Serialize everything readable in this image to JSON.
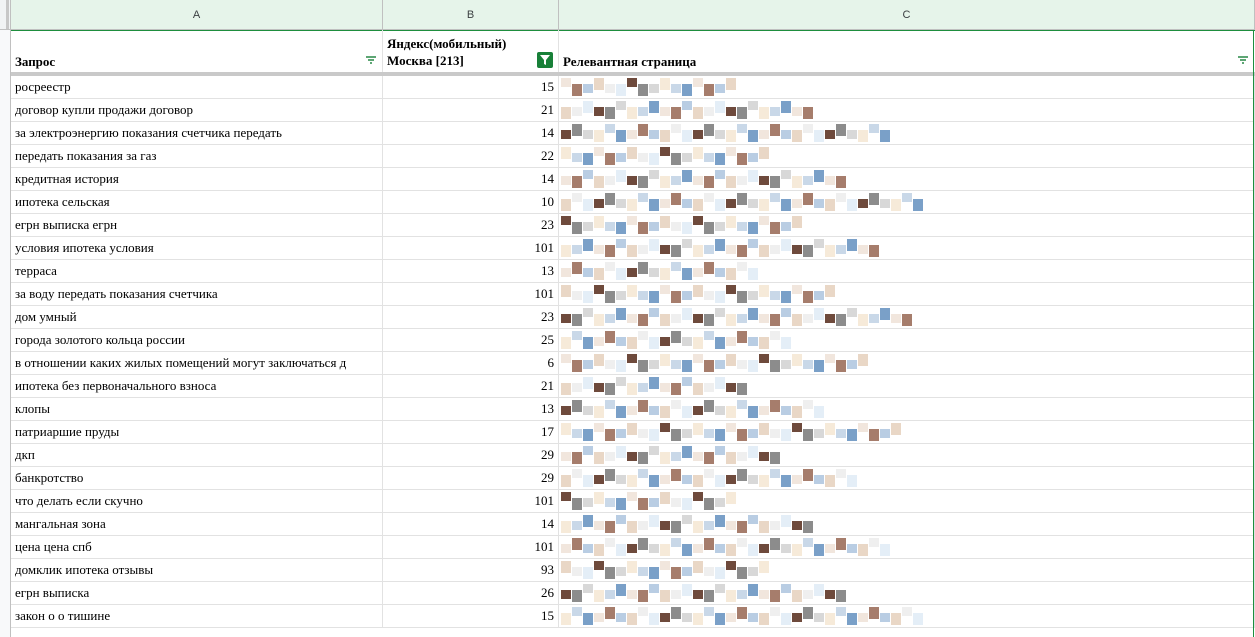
{
  "columns": [
    "A",
    "B",
    "C"
  ],
  "header": {
    "query_label": "Запрос",
    "position_label_line1": "Яндекс(мобильный)",
    "position_label_line2": "Москва [213]",
    "page_label": "Релевантная страница"
  },
  "icons": {
    "filter": "filter-icon",
    "filter_active": "filter-active-icon"
  },
  "colors": {
    "header_bg": "#e6f4ea",
    "accent_green": "#188038"
  },
  "rows": [
    {
      "query": "росреестр",
      "position": "15"
    },
    {
      "query": "договор купли продажи договор",
      "position": "21"
    },
    {
      "query": "за электроэнергию показания счетчика передать",
      "position": "14"
    },
    {
      "query": "передать показания за газ",
      "position": "22"
    },
    {
      "query": "кредитная история",
      "position": "14"
    },
    {
      "query": "ипотека сельская",
      "position": "10"
    },
    {
      "query": "егрн выписка егрн",
      "position": "23"
    },
    {
      "query": "условия ипотека условия",
      "position": "101"
    },
    {
      "query": "терраса",
      "position": "13"
    },
    {
      "query": "за воду передать показания счетчика",
      "position": "101"
    },
    {
      "query": "дом умный",
      "position": "23"
    },
    {
      "query": "города золотого кольца россии",
      "position": "25"
    },
    {
      "query": "в отношении каких жилых помещений могут заключаться д",
      "position": "6"
    },
    {
      "query": "ипотека без первоначального взноса",
      "position": "21"
    },
    {
      "query": "клопы",
      "position": "13"
    },
    {
      "query": "патриаршие пруды",
      "position": "17"
    },
    {
      "query": "дкп",
      "position": "29"
    },
    {
      "query": "банкротство",
      "position": "29"
    },
    {
      "query": "что делать если скучно",
      "position": "101"
    },
    {
      "query": "мангальная зона",
      "position": "14"
    },
    {
      "query": "цена цена спб",
      "position": "101"
    },
    {
      "query": "домклик ипотека отзывы",
      "position": "93"
    },
    {
      "query": "егрн выписка",
      "position": "26"
    },
    {
      "query": "закон о о тишине",
      "position": "15"
    }
  ]
}
